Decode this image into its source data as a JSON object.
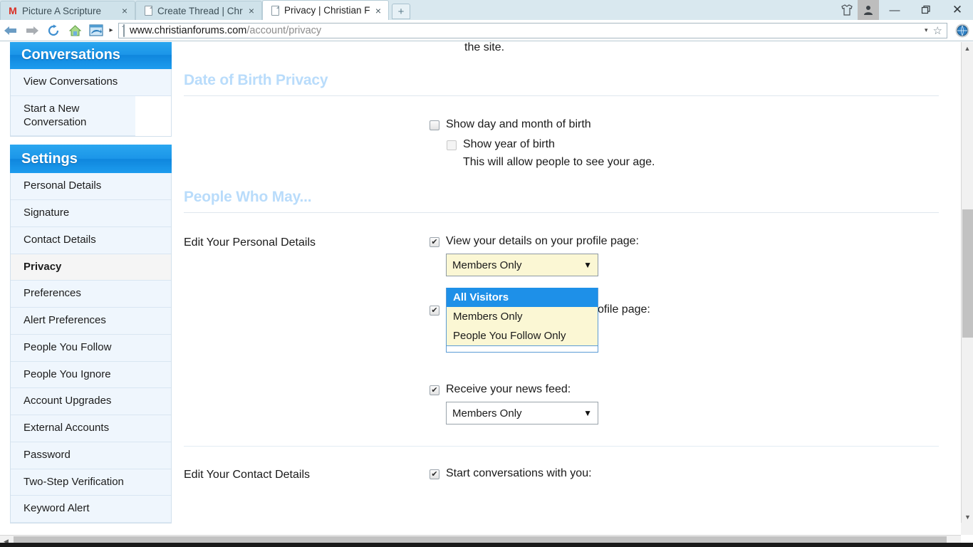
{
  "browser": {
    "tabs": [
      {
        "title": "Picture A Scripture",
        "icon": "gmail-icon",
        "active": false
      },
      {
        "title": "Create Thread | Chr",
        "icon": "page-icon",
        "active": false
      },
      {
        "title": "Privacy | Christian F",
        "icon": "page-icon",
        "active": true
      }
    ],
    "new_tab_label": "+",
    "close_label": "×",
    "window_controls": {
      "shirt": "theme-icon",
      "person": "account-icon",
      "minimize": "—",
      "maximize": "❐",
      "close": "✕"
    },
    "toolbar": {
      "back": "back-arrow",
      "forward": "forward-arrow",
      "reload": "reload-icon",
      "home": "home-icon",
      "feeds": "feeds-icon",
      "overflow": "▸",
      "star": "☆",
      "settings": "globe-gear-icon"
    },
    "address": {
      "domain": "www.christianforums.com",
      "path": "/account/privacy",
      "caret": "▾"
    }
  },
  "sidebar": {
    "conversations": {
      "heading": "Conversations",
      "items": [
        {
          "label": "View Conversations",
          "active": false
        },
        {
          "label": "Start a New Conversation",
          "active": false
        }
      ]
    },
    "settings": {
      "heading": "Settings",
      "items": [
        {
          "label": "Personal Details",
          "active": false
        },
        {
          "label": "Signature",
          "active": false
        },
        {
          "label": "Contact Details",
          "active": false
        },
        {
          "label": "Privacy",
          "active": true
        },
        {
          "label": "Preferences",
          "active": false
        },
        {
          "label": "Alert Preferences",
          "active": false
        },
        {
          "label": "People You Follow",
          "active": false
        },
        {
          "label": "People You Ignore",
          "active": false
        },
        {
          "label": "Account Upgrades",
          "active": false
        },
        {
          "label": "External Accounts",
          "active": false
        },
        {
          "label": "Password",
          "active": false
        },
        {
          "label": "Two-Step Verification",
          "active": false
        },
        {
          "label": "Keyword Alert",
          "active": false
        }
      ]
    }
  },
  "main": {
    "clipped_text": "the site.",
    "dob_section": {
      "heading": "Date of Birth Privacy",
      "show_day_month": "Show day and month of birth",
      "show_year": "Show year of birth",
      "age_note": "This will allow people to see your age.",
      "show_day_month_checked": false,
      "show_year_checked": false
    },
    "people_section": {
      "heading": "People Who May...",
      "rows": [
        {
          "label": "Edit Your Personal Details",
          "fields": [
            {
              "checkbox_label": "View your details on your profile page:",
              "checked": true,
              "select_value": "Members Only",
              "open": true,
              "options": [
                "All Visitors",
                "Members Only",
                "People You Follow Only"
              ],
              "highlighted_option": "All Visitors"
            },
            {
              "checkbox_label": "ofile page:",
              "checked": true
            },
            {
              "checkbox_label": "Receive your news feed:",
              "checked": true,
              "select_value": "Members Only",
              "open": false
            }
          ]
        },
        {
          "label": "Edit Your Contact Details",
          "fields": [
            {
              "checkbox_label": "Start conversations with you:",
              "checked": true
            }
          ]
        }
      ]
    },
    "caret": "▼",
    "check_glyph": "✔"
  },
  "scroll": {
    "up_arrow": "▲",
    "down_arrow": "▼",
    "left_arrow": "◀",
    "right_arrow": "▶"
  },
  "colors": {
    "accent_blue": "#1b95e8",
    "heading_blue": "#b9dcfb",
    "highlight_blue": "#1e90e8",
    "select_yellow": "#fbf7d4"
  }
}
